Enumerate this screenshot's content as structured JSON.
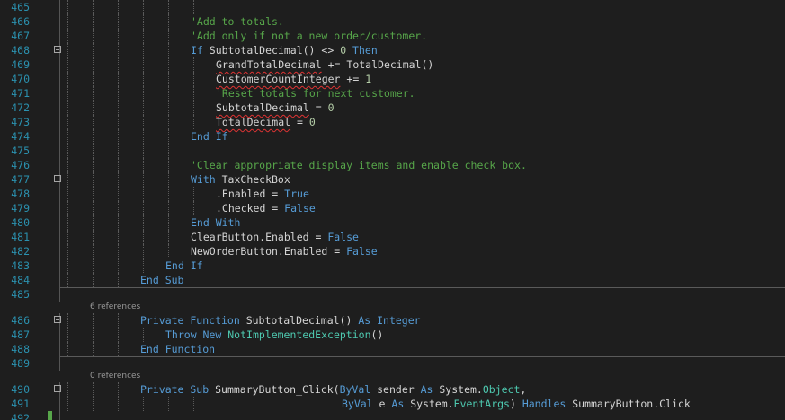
{
  "editor": {
    "lines": [
      {
        "n": "465",
        "indent": 0,
        "tokens": []
      },
      {
        "n": "466",
        "indent": 5,
        "tokens": [
          {
            "t": "'Add to totals.",
            "c": "c"
          }
        ]
      },
      {
        "n": "467",
        "indent": 5,
        "tokens": [
          {
            "t": "'Add only if not a new order/customer.",
            "c": "c"
          }
        ]
      },
      {
        "n": "468",
        "indent": 5,
        "fold": true,
        "tokens": [
          {
            "t": "If ",
            "c": "k"
          },
          {
            "t": "SubtotalDecimal() <> ",
            "c": "t"
          },
          {
            "t": "0",
            "c": "n"
          },
          {
            "t": " Then",
            "c": "k"
          }
        ]
      },
      {
        "n": "469",
        "indent": 6,
        "tokens": [
          {
            "t": "GrandTotalDecimal",
            "c": "t",
            "sq": true
          },
          {
            "t": " += TotalDecimal()",
            "c": "t"
          }
        ]
      },
      {
        "n": "470",
        "indent": 6,
        "tokens": [
          {
            "t": "CustomerCountInteger",
            "c": "t",
            "sq": true
          },
          {
            "t": " += ",
            "c": "t"
          },
          {
            "t": "1",
            "c": "n"
          }
        ]
      },
      {
        "n": "471",
        "indent": 6,
        "tokens": [
          {
            "t": "'Reset totals for next customer.",
            "c": "c"
          }
        ]
      },
      {
        "n": "472",
        "indent": 6,
        "tokens": [
          {
            "t": "SubtotalDecimal",
            "c": "t",
            "sq": true
          },
          {
            "t": " = ",
            "c": "t"
          },
          {
            "t": "0",
            "c": "n"
          }
        ]
      },
      {
        "n": "473",
        "indent": 6,
        "tokens": [
          {
            "t": "TotalDecimal",
            "c": "t",
            "sq": true
          },
          {
            "t": " = ",
            "c": "t"
          },
          {
            "t": "0",
            "c": "n"
          }
        ]
      },
      {
        "n": "474",
        "indent": 5,
        "tokens": [
          {
            "t": "End If",
            "c": "k"
          }
        ]
      },
      {
        "n": "475",
        "indent": 0,
        "tokens": []
      },
      {
        "n": "476",
        "indent": 5,
        "tokens": [
          {
            "t": "'Clear appropriate display items and enable check box.",
            "c": "c"
          }
        ]
      },
      {
        "n": "477",
        "indent": 5,
        "fold": true,
        "tokens": [
          {
            "t": "With ",
            "c": "k"
          },
          {
            "t": "TaxCheckBox",
            "c": "t"
          }
        ]
      },
      {
        "n": "478",
        "indent": 6,
        "tokens": [
          {
            "t": ".Enabled = ",
            "c": "t"
          },
          {
            "t": "True",
            "c": "k"
          }
        ]
      },
      {
        "n": "479",
        "indent": 6,
        "tokens": [
          {
            "t": ".Checked = ",
            "c": "t"
          },
          {
            "t": "False",
            "c": "k"
          }
        ]
      },
      {
        "n": "480",
        "indent": 5,
        "tokens": [
          {
            "t": "End With",
            "c": "k"
          }
        ]
      },
      {
        "n": "481",
        "indent": 5,
        "tokens": [
          {
            "t": "ClearButton.Enabled = ",
            "c": "t"
          },
          {
            "t": "False",
            "c": "k"
          }
        ]
      },
      {
        "n": "482",
        "indent": 5,
        "tokens": [
          {
            "t": "NewOrderButton.Enabled = ",
            "c": "t"
          },
          {
            "t": "False",
            "c": "k"
          }
        ]
      },
      {
        "n": "483",
        "indent": 4,
        "tokens": [
          {
            "t": "End If",
            "c": "k"
          }
        ]
      },
      {
        "n": "484",
        "indent": 3,
        "tokens": [
          {
            "t": "End Sub",
            "c": "k"
          }
        ],
        "sepAfter": true
      },
      {
        "n": "485",
        "indent": 0,
        "tokens": []
      },
      {
        "lens": "6 references"
      },
      {
        "n": "486",
        "indent": 3,
        "fold": true,
        "tokens": [
          {
            "t": "Private Function ",
            "c": "k"
          },
          {
            "t": "SubtotalDecimal() ",
            "c": "t"
          },
          {
            "t": "As Integer",
            "c": "k"
          }
        ]
      },
      {
        "n": "487",
        "indent": 4,
        "tokens": [
          {
            "t": "Throw New ",
            "c": "k"
          },
          {
            "t": "NotImplementedException",
            "c": "ty"
          },
          {
            "t": "()",
            "c": "t"
          }
        ]
      },
      {
        "n": "488",
        "indent": 3,
        "tokens": [
          {
            "t": "End Function",
            "c": "k"
          }
        ],
        "sepAfter": true
      },
      {
        "n": "489",
        "indent": 0,
        "tokens": []
      },
      {
        "lens": "0 references"
      },
      {
        "n": "490",
        "indent": 3,
        "fold": true,
        "tokens": [
          {
            "t": "Private Sub ",
            "c": "k"
          },
          {
            "t": "SummaryButton_Click(",
            "c": "t"
          },
          {
            "t": "ByVal ",
            "c": "k"
          },
          {
            "t": "sender ",
            "c": "t"
          },
          {
            "t": "As ",
            "c": "k"
          },
          {
            "t": "System.",
            "c": "t"
          },
          {
            "t": "Object",
            "c": "ty"
          },
          {
            "t": ",",
            "c": "t"
          }
        ]
      },
      {
        "n": "491",
        "indent": 11,
        "tokens": [
          {
            "t": "ByVal ",
            "c": "k"
          },
          {
            "t": "e ",
            "c": "t"
          },
          {
            "t": "As ",
            "c": "k"
          },
          {
            "t": "System.",
            "c": "t"
          },
          {
            "t": "EventArgs",
            "c": "ty"
          },
          {
            "t": ") ",
            "c": "t"
          },
          {
            "t": "Handles ",
            "c": "k"
          },
          {
            "t": "SummaryButton.Click",
            "c": "t"
          }
        ]
      },
      {
        "n": "492",
        "indent": 0,
        "tokens": [],
        "mod": true
      }
    ]
  }
}
